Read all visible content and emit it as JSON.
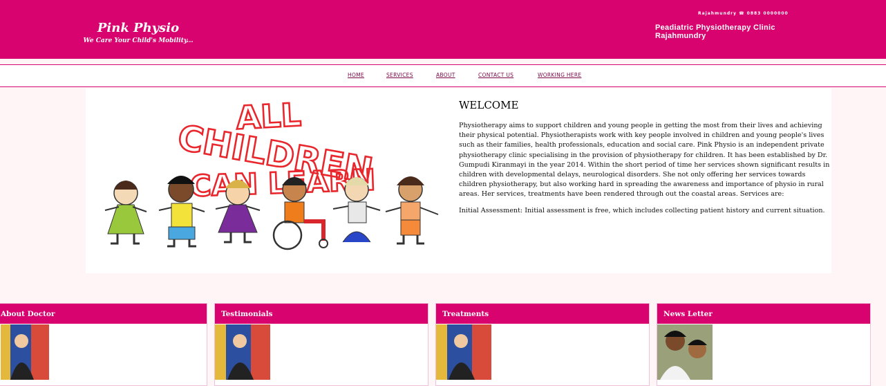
{
  "header": {
    "brand_name": "Pink Physio",
    "brand_tagline": "We Care Your Child's Mobility...",
    "contact": "Rajahmundry ☎ 0883 0000000",
    "clinic_line1": "Peadiatric Physiotherapy Clinic",
    "clinic_line2": "Rajahmundry"
  },
  "nav": {
    "home": "HOME",
    "services": "SERVICES",
    "about": "ABOUT",
    "contact": "CONTACT US",
    "working": "WORKING HERE"
  },
  "hero": {
    "art_text": [
      "ALL",
      "CHILDREN",
      "CAN LEARN"
    ],
    "welcome_title": "WELCOME",
    "paragraph1": "Physiotherapy aims to support children and young people in getting the most from their lives and achieving their physical potential. Physiotherapists work with key people involved in children and young people's lives such as their families, health professionals, education and social care. Pink Physio is an independent private physiotherapy clinic specialising in the provision of physiotherapy for children. It has been established by Dr. Gumpudi Kiranmayi in the year 2014. Within the short period of time her services shown significant results in children with developmental delays, neurological disorders. She not only offering her services towards children physiotherapy, but also working hard in spreading the awareness and importance of physio in rural areas. Her services, treatments have been rendered through out the coastal areas. Services are:",
    "paragraph2": "Initial Assessment: Initial assessment is free, which includes collecting patient history and current situation."
  },
  "boxes": {
    "about_doctor": "About Doctor",
    "testimonials": "Testimonials",
    "treatments": "Treatments",
    "news_letter": "News Letter"
  },
  "colors": {
    "brand_pink": "#d8036f",
    "background": "#fff5f6",
    "nav_text": "#7a0648"
  }
}
